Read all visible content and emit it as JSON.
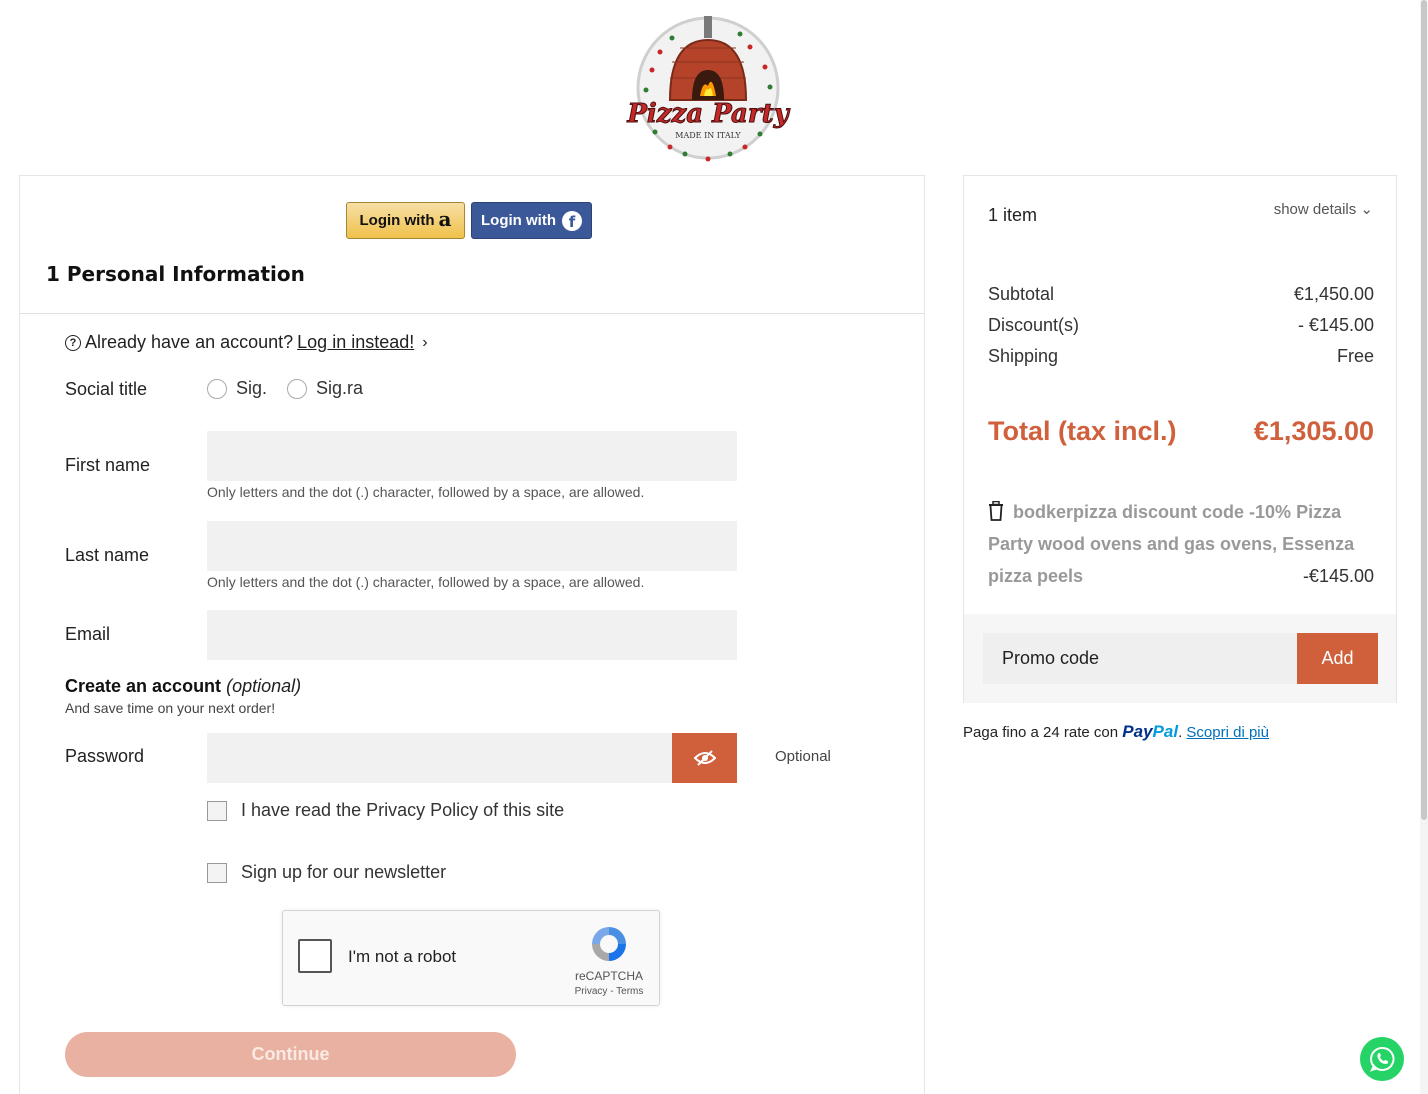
{
  "logo": {
    "brand_text": "Pizza Party",
    "tagline": "MADE IN ITALY"
  },
  "social_login": {
    "amazon_label": "Login with",
    "facebook_label": "Login with",
    "amazon_icon": "amazon-icon",
    "facebook_icon": "facebook-icon"
  },
  "step": {
    "title": "1 Personal Information"
  },
  "account_prompt": {
    "text": "Already have an account?",
    "link": "Log in instead!"
  },
  "form": {
    "social_title_label": "Social title",
    "social_title_options": [
      "Sig.",
      "Sig.ra"
    ],
    "first_name_label": "First name",
    "last_name_label": "Last name",
    "name_hint": "Only letters and the dot (.) character, followed by a space, are allowed.",
    "email_label": "Email",
    "create_account_label": "Create an account",
    "create_account_optional": "(optional)",
    "create_account_sub": "And save time on your next order!",
    "password_label": "Password",
    "password_optional": "Optional",
    "privacy_label": "I have read the Privacy Policy of this site",
    "newsletter_label": "Sign up for our newsletter",
    "continue_label": "Continue"
  },
  "recaptcha": {
    "label": "I'm not a robot",
    "brand": "reCAPTCHA",
    "terms": "Privacy - Terms"
  },
  "summary": {
    "items_count": "1 item",
    "show_details": "show details",
    "subtotal_label": "Subtotal",
    "subtotal_value": "€1,450.00",
    "discount_label": "Discount(s)",
    "discount_value": "- €145.00",
    "shipping_label": "Shipping",
    "shipping_value": "Free",
    "total_label": "Total (tax incl.)",
    "total_value": "€1,305.00",
    "voucher_name": "bodkerpizza discount code -10% Pizza Party wood ovens and gas ovens, Essenza pizza peels",
    "voucher_value": "-€145.00",
    "promo_placeholder": "Promo code",
    "promo_button": "Add"
  },
  "paypal": {
    "text": "Paga fino a 24 rate con",
    "brand_pay": "Pay",
    "brand_pal": "Pal",
    "link": "Scopri di più"
  },
  "colors": {
    "accent": "#d0603c",
    "continue_disabled": "#e8b1a1",
    "amazon": "#f0c14b",
    "facebook": "#3b5998",
    "whatsapp": "#25d366"
  }
}
